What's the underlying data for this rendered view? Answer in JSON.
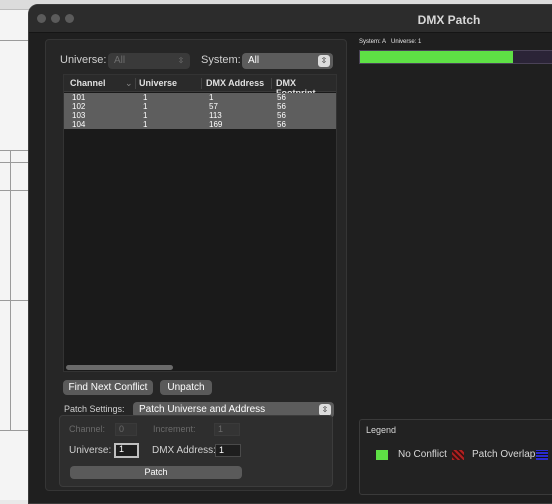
{
  "window": {
    "title": "DMX Patch"
  },
  "filters": {
    "universe_label": "Universe:",
    "universe_value": "All",
    "system_label": "System:",
    "system_value": "All"
  },
  "table": {
    "columns": [
      "Channel",
      "Universe",
      "DMX Address",
      "DMX Footprint"
    ],
    "rows": [
      {
        "channel": "101",
        "universe": "1",
        "address": "1",
        "footprint": "56"
      },
      {
        "channel": "102",
        "universe": "1",
        "address": "57",
        "footprint": "56"
      },
      {
        "channel": "103",
        "universe": "1",
        "address": "113",
        "footprint": "56"
      },
      {
        "channel": "104",
        "universe": "1",
        "address": "169",
        "footprint": "56"
      }
    ]
  },
  "buttons": {
    "find_next_conflict": "Find Next Conflict",
    "unpatch": "Unpatch",
    "patch": "Patch"
  },
  "patch_settings": {
    "label": "Patch Settings:",
    "mode": "Patch Universe and Address",
    "channel_label": "Channel:",
    "channel_value": "0",
    "increment_label": "Increment:",
    "increment_value": "1",
    "universe_label": "Universe:",
    "universe_value": "1",
    "dmx_address_label": "DMX Address:",
    "dmx_address_value": "1"
  },
  "universe_view": {
    "system_label": "System: A",
    "universe_label": "Universe: 1",
    "used_fraction": 0.73
  },
  "legend": {
    "title": "Legend",
    "items": [
      {
        "label": "No Conflict",
        "color": "#5ee045"
      },
      {
        "label": "Patch Overlap",
        "color": "#b02020"
      },
      {
        "label": "",
        "color": "#2a2ad0"
      }
    ]
  },
  "colors": {
    "no_conflict": "#5ee045",
    "free_space": "#2b2437"
  }
}
